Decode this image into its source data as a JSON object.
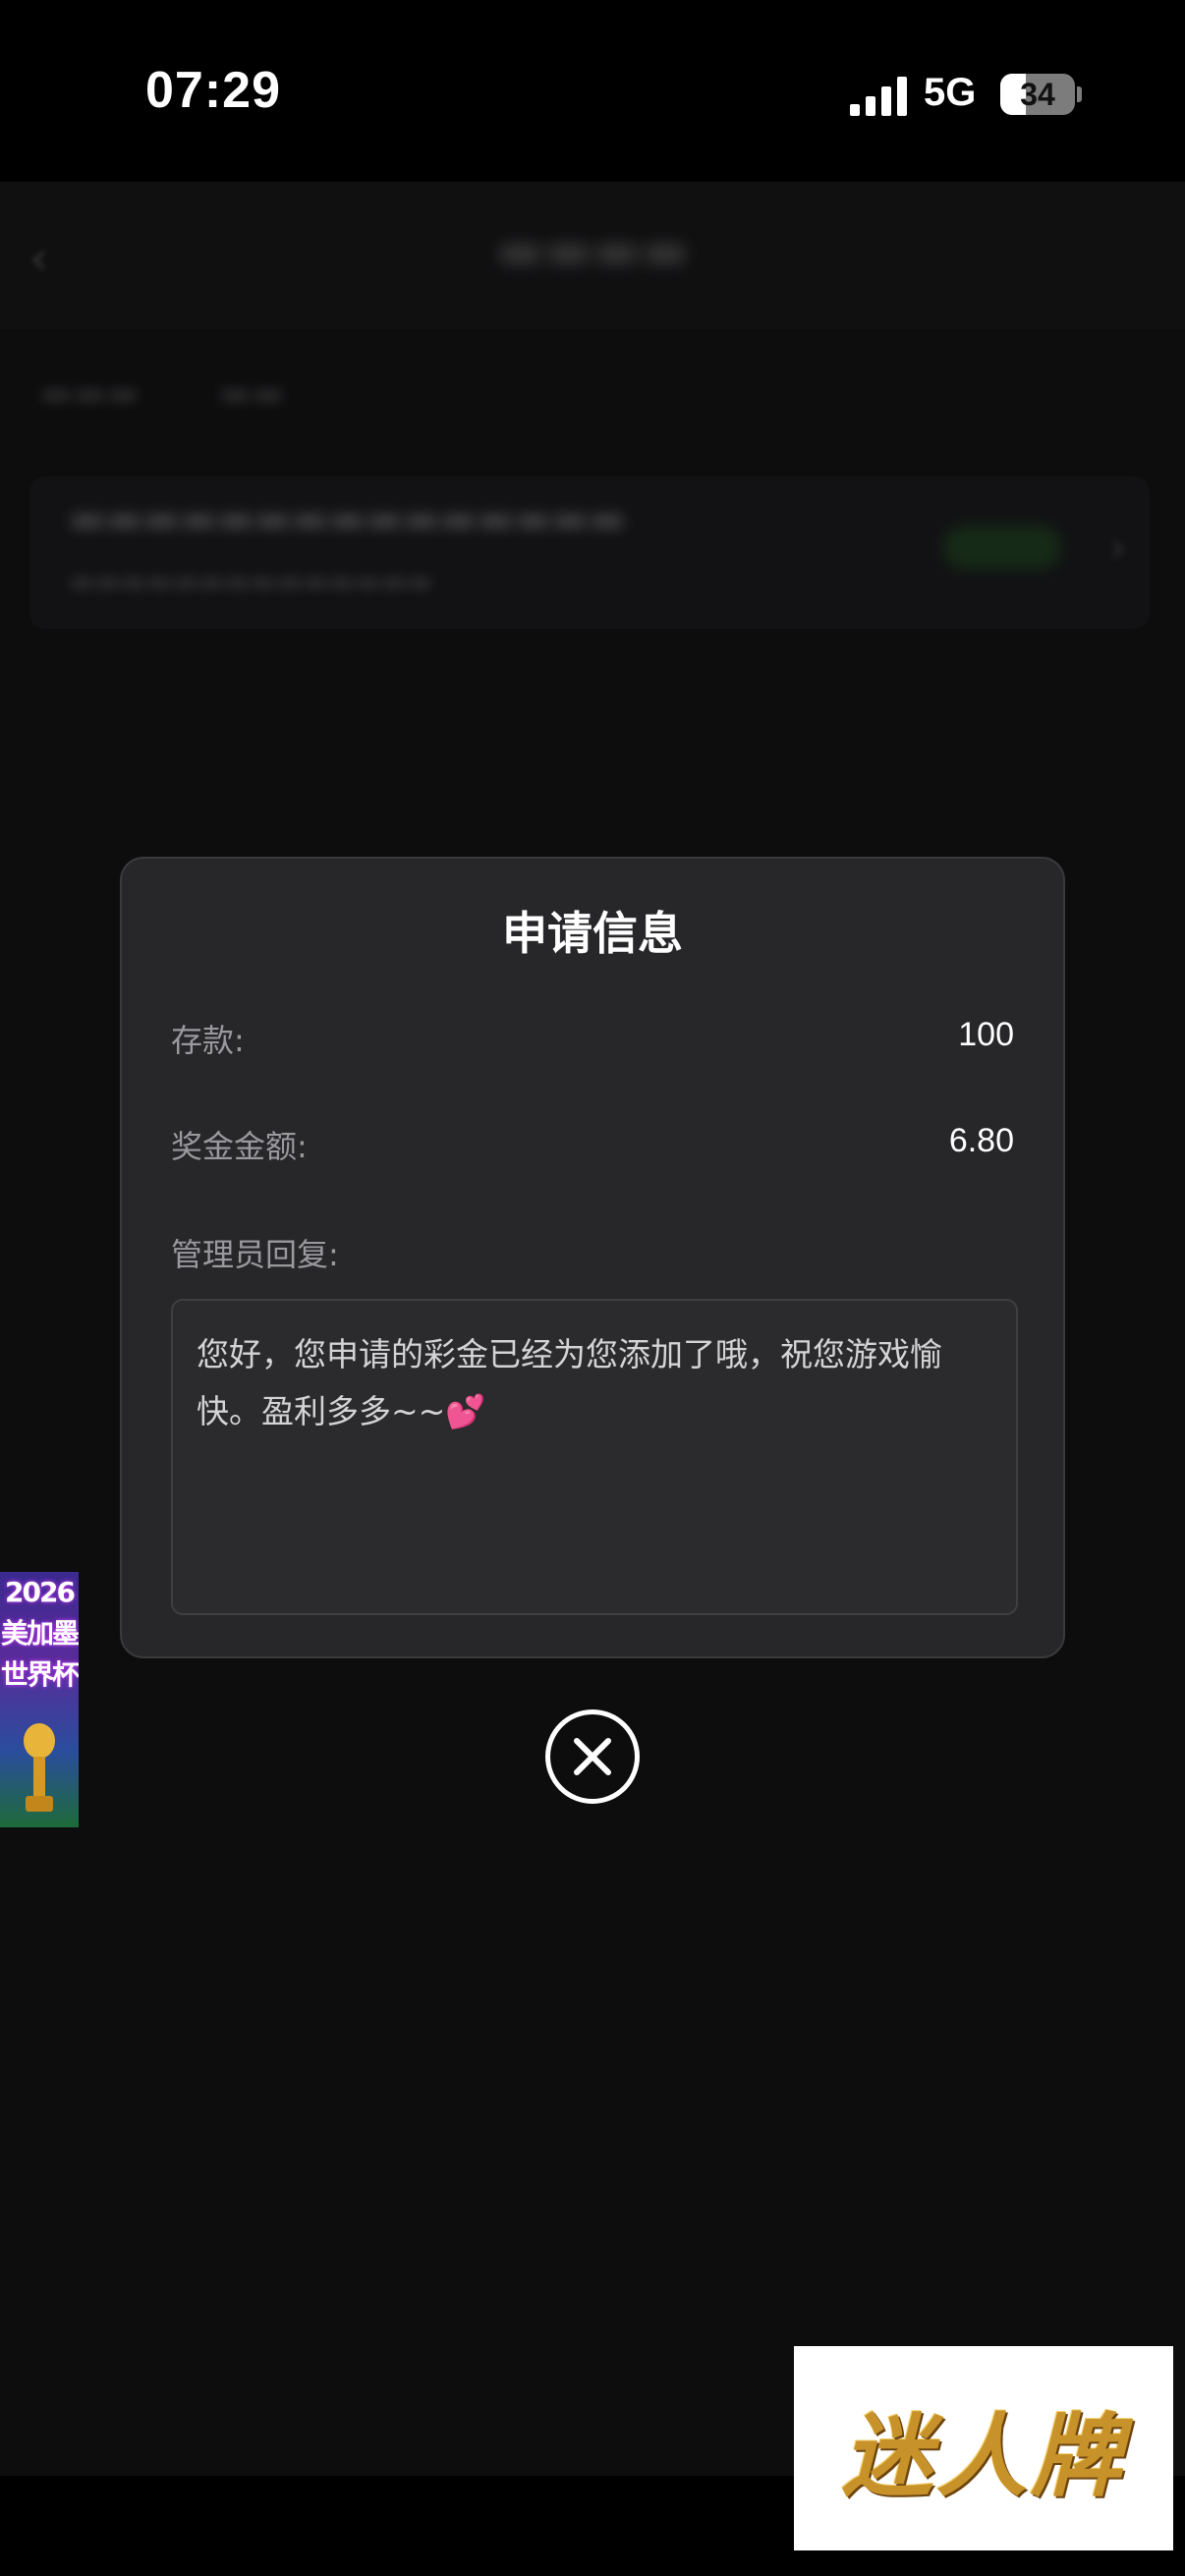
{
  "status_bar": {
    "time": "07:29",
    "network": "5G",
    "battery_level": "34"
  },
  "modal": {
    "title": "申请信息",
    "deposit_label": "存款:",
    "deposit_value": "100",
    "bonus_label": "奖金金额:",
    "bonus_value": "6.80",
    "reply_label": "管理员回复:",
    "reply_text": "您好，您申请的彩金已经为您添加了哦，祝您游戏愉快。盈利多多~~💕"
  },
  "side_banner": {
    "line1": "2026",
    "line2": "美加墨",
    "line3": "世界杯"
  },
  "watermark": {
    "text": "迷人牌"
  },
  "icons": {
    "close": "close-circle-icon",
    "signal": "cellular-signal-icon",
    "battery": "battery-icon"
  },
  "colors": {
    "modal_bg": "#27272a",
    "page_bg": "#111113",
    "label_text": "#9a9a9e",
    "value_text": "#ffffff"
  }
}
